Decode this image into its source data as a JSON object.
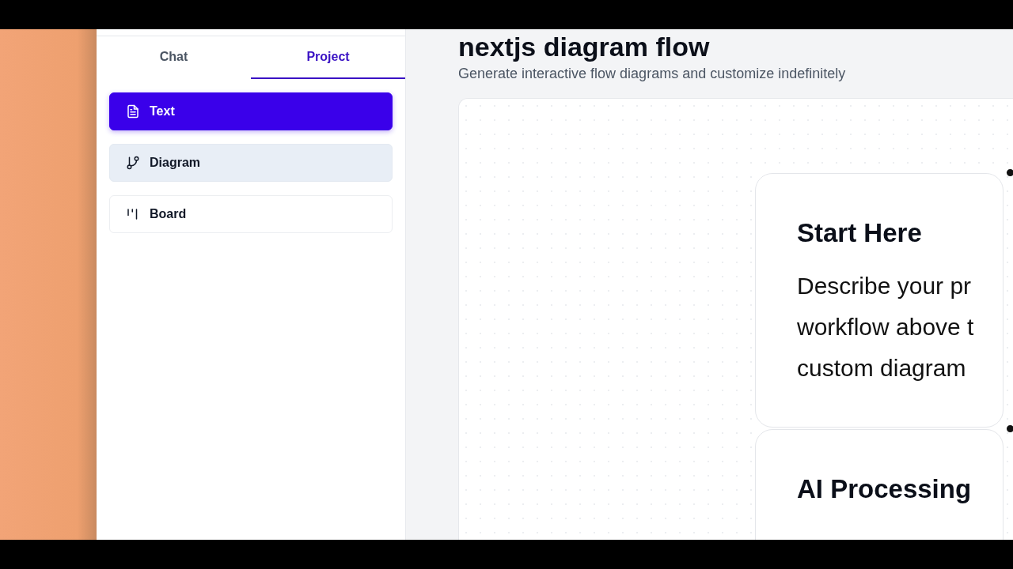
{
  "sidebar": {
    "tabs": [
      {
        "label": "Chat",
        "selected": false
      },
      {
        "label": "Project",
        "selected": true
      }
    ],
    "items": [
      {
        "label": "Text",
        "kind": "text",
        "selected": true,
        "hovered": false
      },
      {
        "label": "Diagram",
        "kind": "diagram",
        "selected": false,
        "hovered": true
      },
      {
        "label": "Board",
        "kind": "board",
        "selected": false,
        "hovered": false
      }
    ]
  },
  "main": {
    "title": "nextjs diagram flow",
    "subtitle": "Generate interactive flow diagrams and customize indefinitely",
    "nodes": [
      {
        "title": "Start Here",
        "lines": [
          "Describe your pr",
          "workflow above t",
          "custom diagram"
        ]
      },
      {
        "title": "AI Processing"
      }
    ]
  }
}
